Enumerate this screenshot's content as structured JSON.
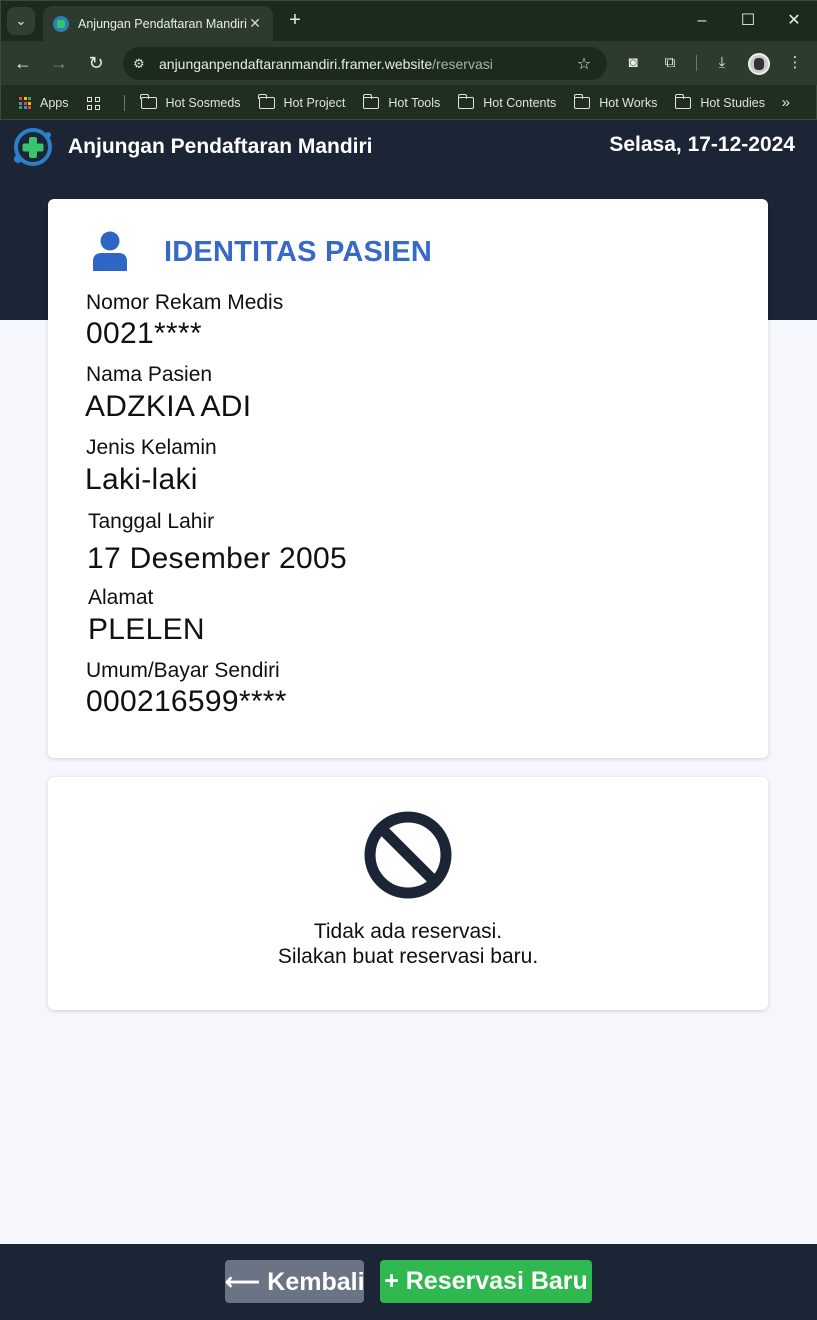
{
  "browser": {
    "tab_title": "Anjungan Pendaftaran Mandiri",
    "url_host": "anjunganpendaftaranmandiri.framer.website",
    "url_path": "/reservasi",
    "bookmarks": [
      "Apps",
      "Hot Sosmeds",
      "Hot Project",
      "Hot Tools",
      "Hot Contents",
      "Hot Works",
      "Hot Studies"
    ]
  },
  "header": {
    "app_title": "Anjungan Pendaftaran Mandiri",
    "date": "Selasa, 17-12-2024"
  },
  "identity": {
    "title": "IDENTITAS PASIEN",
    "fields": [
      {
        "label": "Nomor Rekam Medis",
        "value": "0021****"
      },
      {
        "label": "Nama Pasien",
        "value": "ADZKIA ADI"
      },
      {
        "label": "Jenis Kelamin",
        "value": "Laki-laki"
      },
      {
        "label": "Tanggal Lahir",
        "value": "17 Desember 2005"
      },
      {
        "label": "Alamat",
        "value": "PLELEN"
      },
      {
        "label": "Umum/Bayar Sendiri",
        "value": "000216599****"
      }
    ]
  },
  "reservation": {
    "empty_line1": "Tidak ada reservasi.",
    "empty_line2": "Silakan buat reservasi baru."
  },
  "footer": {
    "back_label": "⟵ Kembali",
    "new_label": "+ Reservasi Baru"
  },
  "colors": {
    "header_bg": "#1b2536",
    "accent_blue": "#3769c9",
    "button_green": "#2eb84f",
    "button_gray": "#6b7484"
  },
  "icons": [
    "user-icon",
    "no-entry-icon",
    "app-logo-icon"
  ]
}
